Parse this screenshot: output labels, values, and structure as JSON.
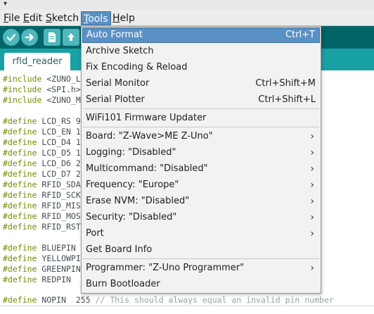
{
  "window": {
    "caret": "▾"
  },
  "menubar": {
    "items": [
      {
        "label": "File"
      },
      {
        "label": "Edit"
      },
      {
        "label": "Sketch"
      },
      {
        "label": "Tools"
      },
      {
        "label": "Help"
      }
    ]
  },
  "toolbar": {
    "buttons": [
      {
        "icon": "checkmark-icon",
        "label": "Verify"
      },
      {
        "icon": "arrow-right-icon",
        "label": "Upload"
      },
      {
        "icon": "new-document-icon",
        "label": "New"
      },
      {
        "icon": "open-icon",
        "label": "Open"
      }
    ],
    "color": "#006468",
    "button_color": "#4db7bb"
  },
  "tabs": [
    {
      "label": "rfid_reader"
    }
  ],
  "editor": {
    "lines": [
      {
        "kw": "#include",
        "rest": " <ZUNO_L"
      },
      {
        "kw": "#include",
        "rest": " <SPI.h>"
      },
      {
        "kw": "#include",
        "rest": " <ZUNO_M"
      },
      {
        "kw": "",
        "rest": ""
      },
      {
        "kw": "#define",
        "rest": " LCD_RS 9"
      },
      {
        "kw": "#define",
        "rest": " LCD_EN 1"
      },
      {
        "kw": "#define",
        "rest": " LCD_D4 1"
      },
      {
        "kw": "#define",
        "rest": " LCD_D5 1"
      },
      {
        "kw": "#define",
        "rest": " LCD_D6 2"
      },
      {
        "kw": "#define",
        "rest": " LCD_D7 2"
      },
      {
        "kw": "#define",
        "rest": " RFID_SDA"
      },
      {
        "kw": "#define",
        "rest": " RFID_SCK"
      },
      {
        "kw": "#define",
        "rest": " RFID_MIS"
      },
      {
        "kw": "#define",
        "rest": " RFID_MOS"
      },
      {
        "kw": "#define",
        "rest": " RFID_RST"
      },
      {
        "kw": "",
        "rest": ""
      },
      {
        "kw": "#define",
        "rest": " BLUEPIN"
      },
      {
        "kw": "#define",
        "rest": " YELLOWPI"
      },
      {
        "kw": "#define",
        "rest": " GREENPIN"
      },
      {
        "kw": "#define",
        "rest": " REDPIN"
      },
      {
        "kw": "",
        "rest": ""
      },
      {
        "kw": "#define",
        "rest": " NOPIN  255 ",
        "comment": "// This should always equal an invalid pin number"
      }
    ]
  },
  "tools_menu": {
    "items": [
      {
        "label": "Auto Format",
        "shortcut": "Ctrl+T",
        "highlighted": true
      },
      {
        "label": "Archive Sketch",
        "shortcut": ""
      },
      {
        "label": "Fix Encoding & Reload",
        "shortcut": ""
      },
      {
        "label": "Serial Monitor",
        "shortcut": "Ctrl+Shift+M"
      },
      {
        "label": "Serial Plotter",
        "shortcut": "Ctrl+Shift+L"
      },
      {
        "label": "WiFi101 Firmware Updater",
        "shortcut": ""
      },
      {
        "label": "Board: \"Z-Wave>ME Z-Uno\"",
        "submenu": true
      },
      {
        "label": "Logging: \"Disabled\"",
        "submenu": true
      },
      {
        "label": "Multicommand: \"Disabled\"",
        "submenu": true
      },
      {
        "label": "Frequency: \"Europe\"",
        "submenu": true
      },
      {
        "label": "Erase NVM: \"Disabled\"",
        "submenu": true
      },
      {
        "label": "Security: \"Disabled\"",
        "submenu": true
      },
      {
        "label": "Port",
        "submenu": true
      },
      {
        "label": "Get Board Info",
        "shortcut": ""
      },
      {
        "label": "Programmer: \"Z-Uno Programmer\"",
        "submenu": true
      },
      {
        "label": "Burn Bootloader",
        "shortcut": ""
      }
    ],
    "submenu_arrow": "›",
    "highlight_color": "#5a91c4"
  }
}
